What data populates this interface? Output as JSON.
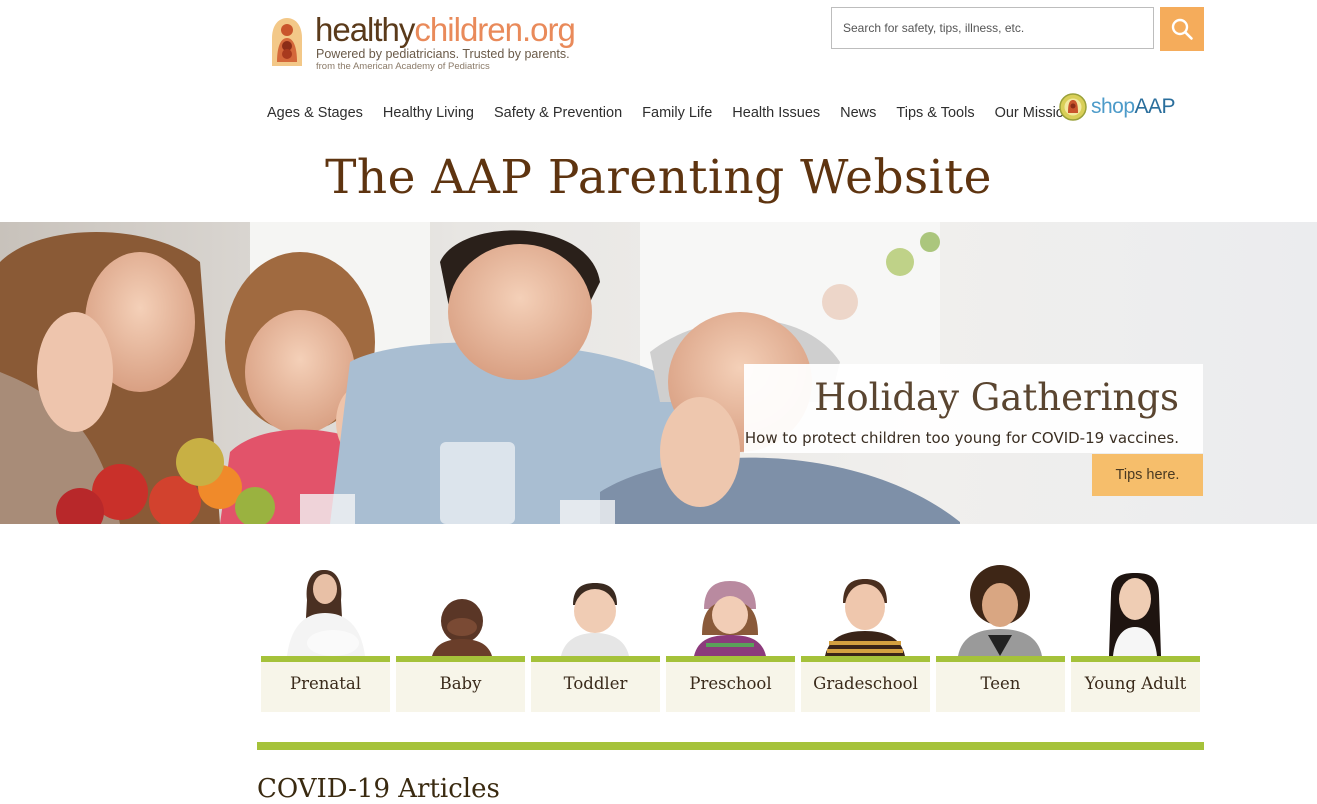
{
  "header": {
    "logo_name_part1": "healthy",
    "logo_name_part2": "children.org",
    "logo_tagline": "Powered by pediatricians. Trusted by parents.",
    "logo_subtitle": "from the American Academy of Pediatrics",
    "search_placeholder": "Search for safety, tips, illness, etc.",
    "search_value": ""
  },
  "nav": {
    "items": [
      {
        "label": "Ages & Stages"
      },
      {
        "label": "Healthy Living"
      },
      {
        "label": "Safety & Prevention"
      },
      {
        "label": "Family Life"
      },
      {
        "label": "Health Issues"
      },
      {
        "label": "News"
      },
      {
        "label": "Tips & Tools"
      },
      {
        "label": "Our Mission"
      }
    ],
    "shop_part1": "shop",
    "shop_part2": "AAP"
  },
  "hero": {
    "title": "The AAP Parenting Website"
  },
  "promo": {
    "title": "Holiday Gatherings",
    "description": "How to protect children too young for COVID-19 vaccines.",
    "button_label": "Tips here."
  },
  "ages": [
    {
      "label": "Prenatal"
    },
    {
      "label": "Baby"
    },
    {
      "label": "Toddler"
    },
    {
      "label": "Preschool"
    },
    {
      "label": "Gradeschool"
    },
    {
      "label": "Teen"
    },
    {
      "label": "Young Adult"
    }
  ],
  "section": {
    "title": "COVID-19 Articles"
  },
  "colors": {
    "brand_brown": "#5e3410",
    "brand_orange": "#e98a5a",
    "search_button": "#f5ac5b",
    "accent_green": "#a5c23a",
    "promo_button": "#f6be6b"
  }
}
